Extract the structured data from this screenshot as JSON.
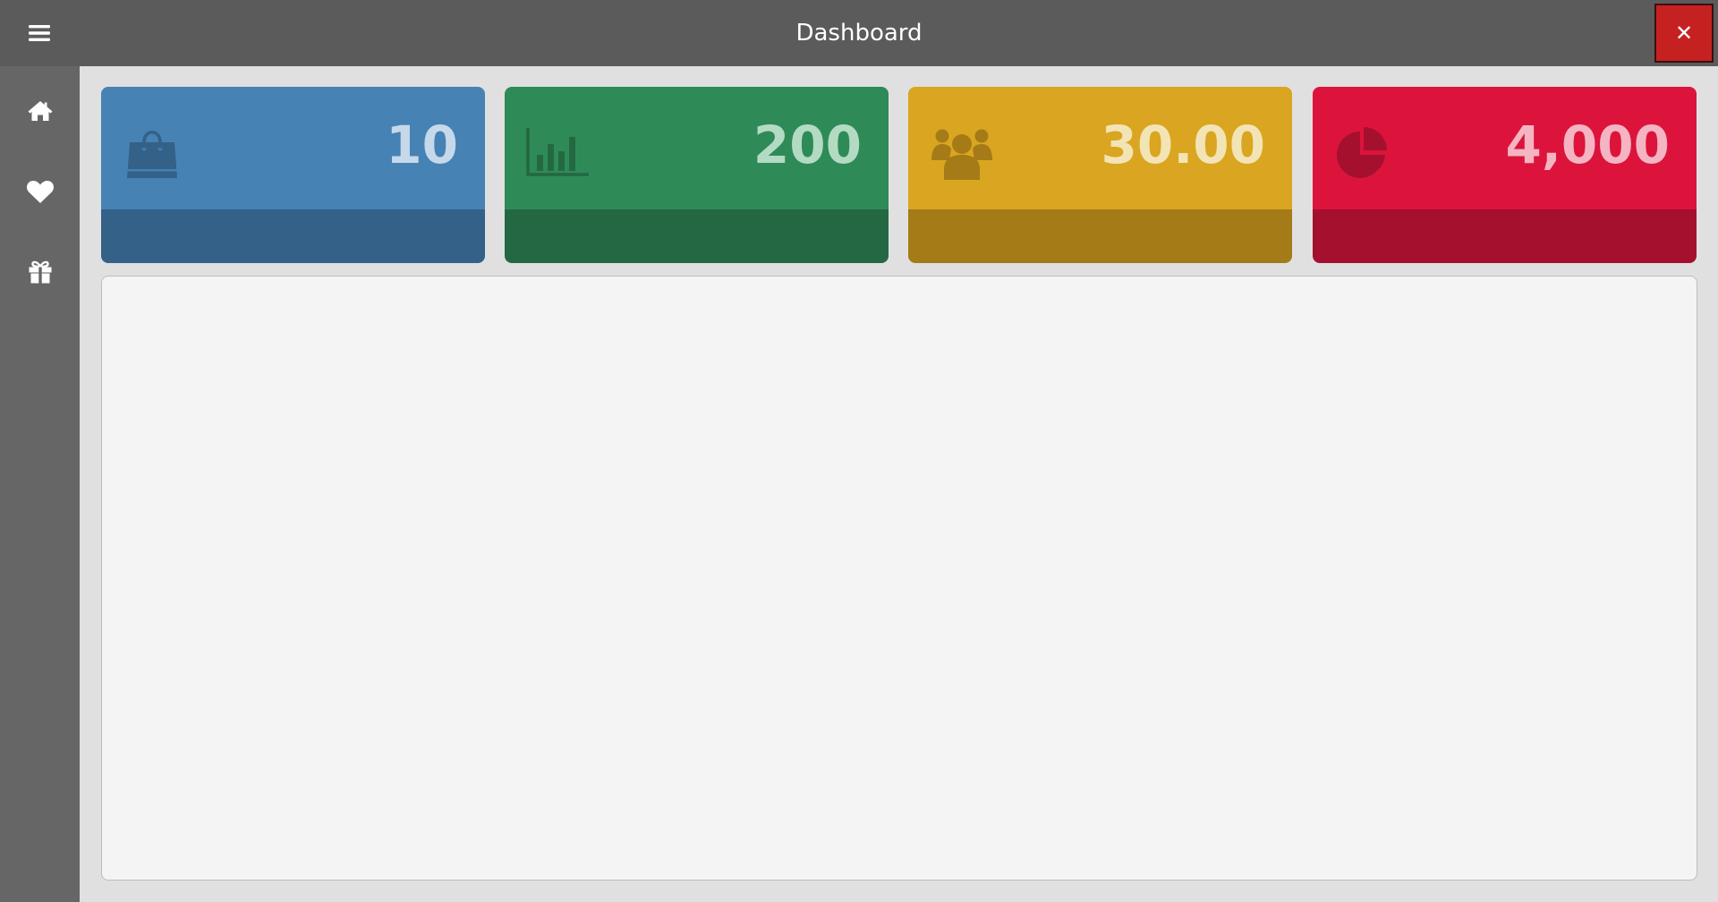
{
  "header": {
    "title": "Dashboard",
    "close_label": "✕"
  },
  "sidebar": {
    "items": [
      {
        "icon": "home-icon"
      },
      {
        "icon": "heart-icon"
      },
      {
        "icon": "gift-icon"
      }
    ]
  },
  "cards": [
    {
      "value": "10",
      "icon": "shopping-bag-icon",
      "color": "#4682b4",
      "footer_color": "#336188",
      "value_color": "#c6d9ea"
    },
    {
      "value": "200",
      "icon": "bar-chart-icon",
      "color": "#2e8b57",
      "footer_color": "#246843",
      "value_color": "#b3dbc3"
    },
    {
      "value": "30.00",
      "icon": "users-icon",
      "color": "#daa520",
      "footer_color": "#a47b17",
      "value_color": "#f3e4b5"
    },
    {
      "value": "4,000",
      "icon": "pie-chart-icon",
      "color": "#dc143c",
      "footer_color": "#a5102e",
      "value_color": "#f5b4c2"
    }
  ]
}
